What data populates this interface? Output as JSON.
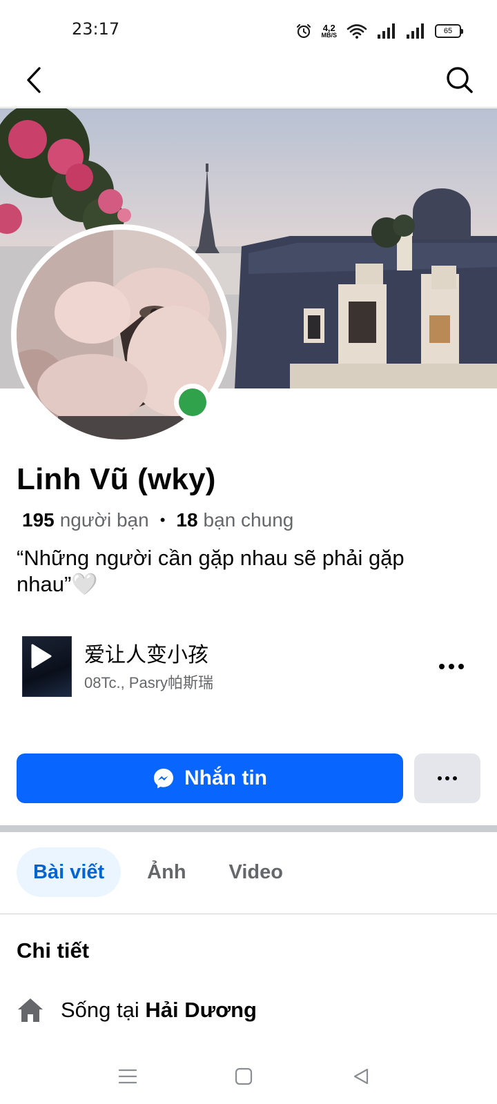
{
  "status_bar": {
    "time": "23:17",
    "net_speed_value": "4,2",
    "net_speed_unit": "MB/S",
    "battery": "65"
  },
  "profile": {
    "name": "Linh Vũ (wky)",
    "friends_count": "195",
    "friends_label": "người bạn",
    "mutual_count": "18",
    "mutual_label": "bạn chung",
    "bio": "“Những người cần gặp nhau sẽ phải gặp nhau”🤍"
  },
  "music": {
    "title": "爱让人变小孩",
    "artist": "08Tc., Pasry帕斯瑞"
  },
  "actions": {
    "message_label": "Nhắn tin"
  },
  "tabs": [
    {
      "label": "Bài viết",
      "active": true
    },
    {
      "label": "Ảnh",
      "active": false
    },
    {
      "label": "Video",
      "active": false
    }
  ],
  "details": {
    "title": "Chi tiết",
    "lives_prefix": "Sống tại",
    "lives_place": "Hải Dương"
  },
  "colors": {
    "brand_blue": "#0866ff",
    "online_green": "#31a24c",
    "tab_active_bg": "#ebf5ff"
  },
  "icons": [
    "back-icon",
    "search-icon",
    "alarm-icon",
    "wifi-icon",
    "signal-icon",
    "battery-icon",
    "play-icon",
    "messenger-icon",
    "more-icon",
    "home-icon",
    "menu-icon",
    "square-icon",
    "back-triangle-icon"
  ]
}
